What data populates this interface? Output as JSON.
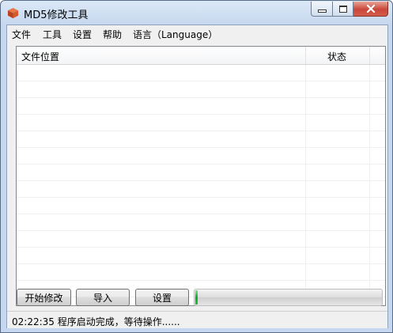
{
  "window": {
    "title": "MD5修改工具",
    "app_icon": "cube-icon"
  },
  "menu": {
    "items": [
      {
        "label": "文件"
      },
      {
        "label": "工具"
      },
      {
        "label": "设置"
      },
      {
        "label": "帮助"
      },
      {
        "label": "语言（Language）"
      }
    ]
  },
  "list": {
    "columns": [
      {
        "label": "文件位置"
      },
      {
        "label": "状态"
      }
    ],
    "rows": []
  },
  "buttons": {
    "start_label": "开始修改",
    "import_label": "导入",
    "settings_label": "设置"
  },
  "progress": {
    "value_percent": 1
  },
  "status": {
    "text": "02:22:35 程序启动完成，等待操作......"
  },
  "colors": {
    "progress_fill": "#06b025",
    "close_button": "#c9473a"
  }
}
